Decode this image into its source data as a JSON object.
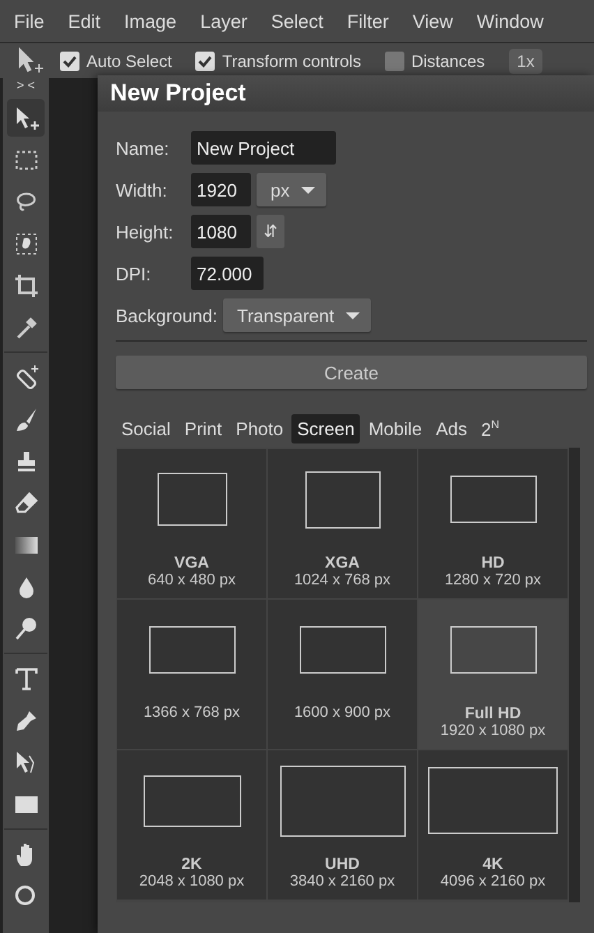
{
  "menu": [
    "File",
    "Edit",
    "Image",
    "Layer",
    "Select",
    "Filter",
    "View",
    "Window"
  ],
  "options_bar": {
    "checks": [
      {
        "label": "Auto Select",
        "checked": true
      },
      {
        "label": "Transform controls",
        "checked": true
      },
      {
        "label": "Distances",
        "checked": false
      }
    ],
    "zoom": "1x"
  },
  "toolbar": {
    "collapse": "> <",
    "groups": [
      [
        {
          "kind": "move",
          "selected": true
        },
        {
          "kind": "marquee",
          "selected": false
        },
        {
          "kind": "lasso",
          "selected": false
        },
        {
          "kind": "quick-select",
          "selected": false
        },
        {
          "kind": "crop",
          "selected": false
        },
        {
          "kind": "eyedropper",
          "selected": false
        }
      ],
      [
        {
          "kind": "heal",
          "selected": false
        },
        {
          "kind": "brush",
          "selected": false
        },
        {
          "kind": "stamp",
          "selected": false
        },
        {
          "kind": "eraser",
          "selected": false
        },
        {
          "kind": "gradient",
          "selected": false
        },
        {
          "kind": "blur",
          "selected": false
        },
        {
          "kind": "dodge",
          "selected": false
        }
      ],
      [
        {
          "kind": "text",
          "selected": false
        },
        {
          "kind": "pen",
          "selected": false
        },
        {
          "kind": "path-select",
          "selected": false
        },
        {
          "kind": "shape",
          "selected": false
        }
      ],
      [
        {
          "kind": "hand",
          "selected": false
        },
        {
          "kind": "zoom",
          "selected": false
        }
      ]
    ]
  },
  "dialog": {
    "title": "New Project",
    "name": {
      "label": "Name:",
      "value": "New Project"
    },
    "width": {
      "label": "Width:",
      "value": "1920",
      "unit": "px"
    },
    "height": {
      "label": "Height:",
      "value": "1080",
      "swap": "⇵"
    },
    "dpi": {
      "label": "DPI:",
      "value": "72.000"
    },
    "background": {
      "label": "Background:",
      "value": "Transparent"
    },
    "create": "Create",
    "tabs": [
      {
        "label": "Social",
        "selected": false
      },
      {
        "label": "Print",
        "selected": false
      },
      {
        "label": "Photo",
        "selected": false
      },
      {
        "label": "Screen",
        "selected": true
      },
      {
        "label": "Mobile",
        "selected": false
      },
      {
        "label": "Ads",
        "selected": false
      },
      {
        "label": "2$^{N}$",
        "selected": false
      }
    ],
    "presets": [
      {
        "size": "640 x 480 px",
        "title": "VGA",
        "kind": "small",
        "selected": false
      },
      {
        "size": "1024 x 768 px",
        "title": "XGA",
        "kind": "medium",
        "selected": false
      },
      {
        "size": "1280 x 720 px",
        "title": "HD",
        "kind": "wide",
        "selected": false
      },
      {
        "size": "1366 x 768 px",
        "kind": "wide",
        "selected": false
      },
      {
        "size": "1600 x 900 px",
        "kind": "wide",
        "selected": false
      },
      {
        "size": "1920 x 1080 px",
        "title": "Full HD",
        "kind": "wide",
        "selected": true
      },
      {
        "size": "2048 x 1080 px",
        "title": "2K",
        "kind": "wider",
        "selected": false
      },
      {
        "size": "3840 x 2160 px",
        "title": "UHD",
        "kind": "large",
        "selected": false
      },
      {
        "size": "4096 x 2160 px",
        "title": "4K",
        "kind": "largest",
        "selected": false
      }
    ]
  }
}
